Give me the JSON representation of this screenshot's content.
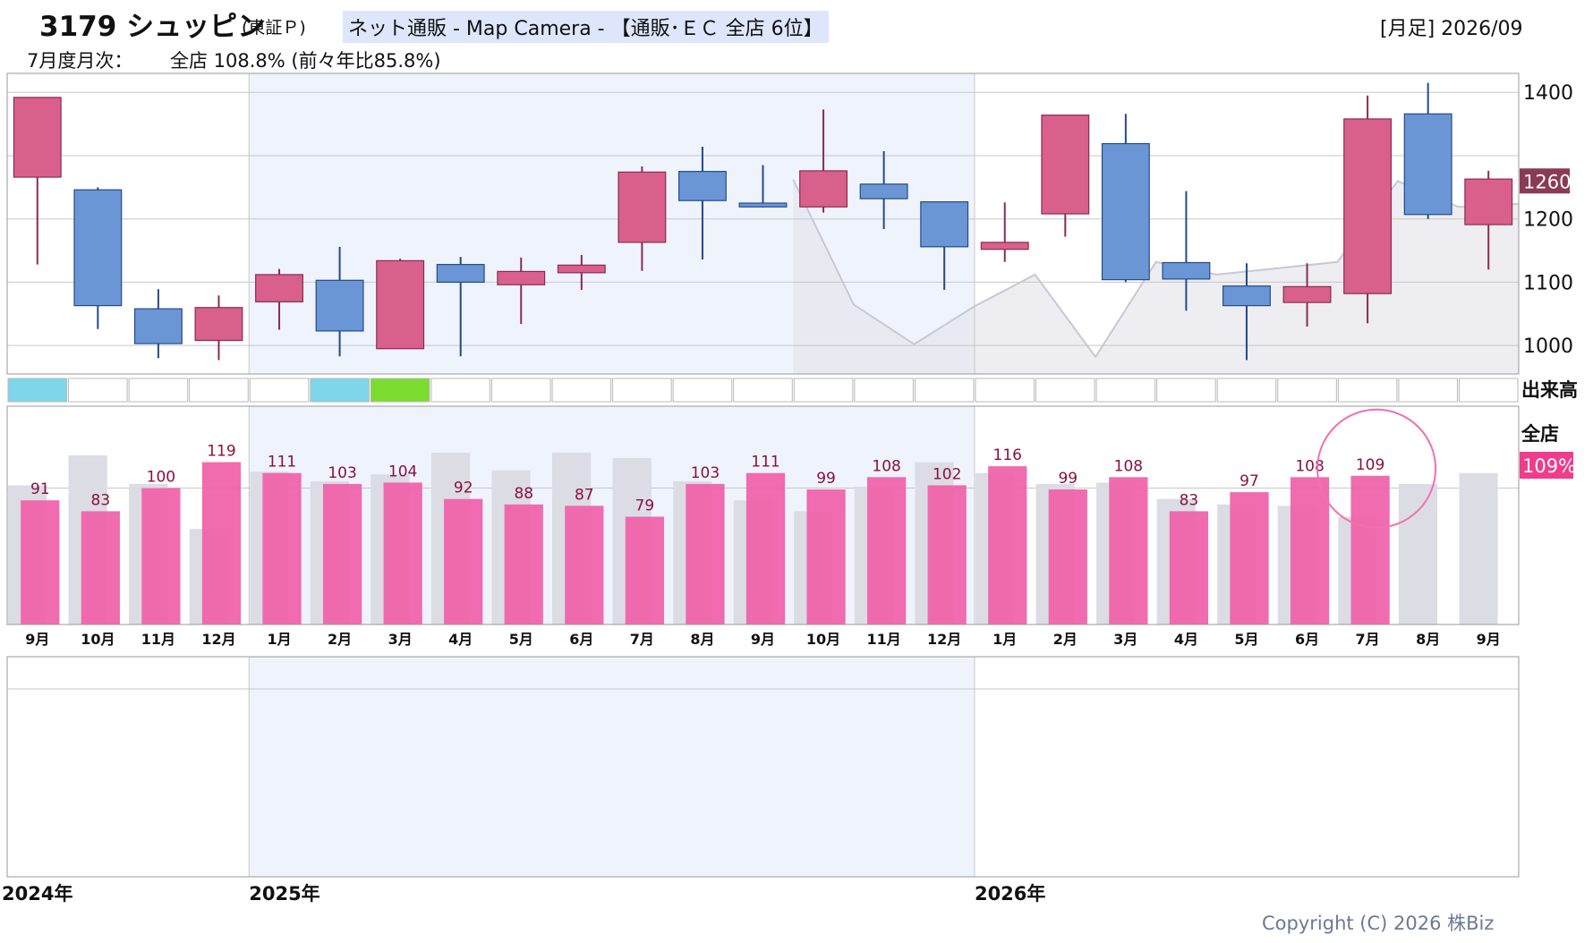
{
  "header": {
    "title": "3179 シュッピン",
    "market": "(東証Ｐ)",
    "sector": "ネット通販 - Map Camera - 【通販･ＥＣ 全店 6位】",
    "period": "[月足] 2026/09",
    "monthly_label": "7月度月次：",
    "monthly_value": "全店 108.8% (前々年比85.8%)"
  },
  "side_labels": {
    "volume": "出来高",
    "store": "全店",
    "store_value": "109%",
    "price_tag": "1260"
  },
  "colors": {
    "up": "#d9608c",
    "down": "#6b96d6",
    "bar_pink": "#f060a8",
    "bar_gray": "#dcdce4",
    "band": "#eef3fc",
    "price_tag_bg": "#8a3a55",
    "store_tag_bg": "#f03c8c"
  },
  "footer": {
    "copyright": "Copyright (C) 2026 株Biz"
  },
  "chart_data": [
    {
      "type": "candlestick",
      "y_ticks": [
        "1400",
        "1200",
        "1100",
        "1000"
      ],
      "ylim": [
        955,
        1430
      ],
      "x_labels": [
        "9月",
        "10月",
        "11月",
        "12月",
        "1月",
        "2月",
        "3月",
        "4月",
        "5月",
        "6月",
        "7月",
        "8月",
        "9月",
        "10月",
        "11月",
        "12月",
        "1月",
        "2月",
        "3月",
        "4月",
        "5月",
        "6月",
        "7月",
        "8月",
        "9月"
      ],
      "year_labels": [
        {
          "label": "2024年",
          "index": 0
        },
        {
          "label": "2025年",
          "index": 4
        },
        {
          "label": "2026年",
          "index": 16
        }
      ],
      "candles": [
        {
          "open": 1266,
          "high": 1266,
          "low": 1128,
          "close": 1392
        },
        {
          "open": 1246,
          "high": 1250,
          "low": 1026,
          "close": 1063
        },
        {
          "open": 1058,
          "high": 1089,
          "low": 980,
          "close": 1003
        },
        {
          "open": 1008,
          "high": 1079,
          "low": 977,
          "close": 1060
        },
        {
          "open": 1069,
          "high": 1121,
          "low": 1025,
          "close": 1112
        },
        {
          "open": 1103,
          "high": 1156,
          "low": 983,
          "close": 1023
        },
        {
          "open": 995,
          "high": 1137,
          "low": 995,
          "close": 1134
        },
        {
          "open": 1128,
          "high": 1140,
          "low": 983,
          "close": 1100
        },
        {
          "open": 1096,
          "high": 1139,
          "low": 1034,
          "close": 1117
        },
        {
          "open": 1115,
          "high": 1143,
          "low": 1088,
          "close": 1127
        },
        {
          "open": 1163,
          "high": 1283,
          "low": 1118,
          "close": 1274
        },
        {
          "open": 1275,
          "high": 1314,
          "low": 1136,
          "close": 1229
        },
        {
          "open": 1225,
          "high": 1285,
          "low": 1218,
          "close": 1219
        },
        {
          "open": 1219,
          "high": 1373,
          "low": 1210,
          "close": 1276
        },
        {
          "open": 1255,
          "high": 1307,
          "low": 1184,
          "close": 1232
        },
        {
          "open": 1227,
          "high": 1227,
          "low": 1088,
          "close": 1156
        },
        {
          "open": 1152,
          "high": 1226,
          "low": 1132,
          "close": 1163
        },
        {
          "open": 1208,
          "high": 1364,
          "low": 1172,
          "close": 1364
        },
        {
          "open": 1319,
          "high": 1366,
          "low": 1100,
          "close": 1104
        },
        {
          "open": 1131,
          "high": 1244,
          "low": 1055,
          "close": 1105
        },
        {
          "open": 1094,
          "high": 1130,
          "low": 977,
          "close": 1063
        },
        {
          "open": 1068,
          "high": 1130,
          "low": 1030,
          "close": 1093
        },
        {
          "open": 1082,
          "high": 1395,
          "low": 1035,
          "close": 1358
        },
        {
          "open": 1366,
          "high": 1415,
          "low": 1200,
          "close": 1207
        },
        {
          "open": 1191,
          "high": 1276,
          "low": 1120,
          "close": 1263
        }
      ]
    },
    {
      "type": "bar",
      "categories": [
        "9月",
        "10月",
        "11月",
        "12月",
        "1月",
        "2月",
        "3月",
        "4月",
        "5月",
        "6月",
        "7月",
        "8月",
        "9月",
        "10月",
        "11月",
        "12月",
        "1月",
        "2月",
        "3月",
        "4月",
        "5月",
        "6月",
        "7月",
        "8月",
        "9月"
      ],
      "series": [
        {
          "values": [
            91,
            83,
            100,
            119,
            111,
            103,
            104,
            92,
            88,
            87,
            79,
            103,
            111,
            99,
            108,
            102,
            116,
            99,
            108,
            83,
            97,
            108,
            109,
            null,
            null
          ]
        },
        {
          "values": [
            102,
            124,
            103,
            70,
            112,
            105,
            110,
            126,
            113,
            126,
            122,
            105,
            91,
            83,
            101,
            119,
            111,
            103,
            104,
            92,
            88,
            87,
            79,
            103,
            111
          ]
        }
      ],
      "highlighted": "109"
    }
  ]
}
